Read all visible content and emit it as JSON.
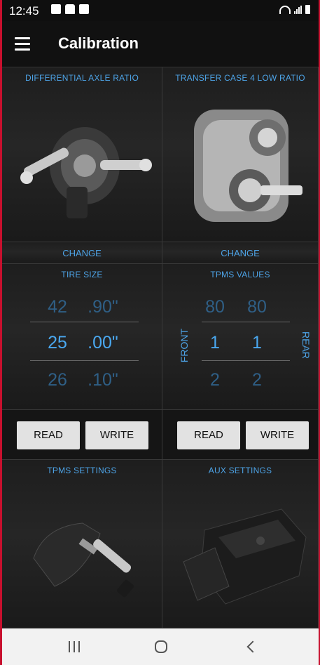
{
  "status_bar": {
    "time": "12:45"
  },
  "app_bar": {
    "title": "Calibration"
  },
  "axle_panel": {
    "label": "DIFFERENTIAL AXLE RATIO",
    "change": "CHANGE"
  },
  "transfer_panel": {
    "label": "TRANSFER CASE 4 LOW RATIO",
    "change": "CHANGE"
  },
  "tire_panel": {
    "label": "TIRE SIZE",
    "rows": [
      {
        "whole": "42",
        "frac": ".90\""
      },
      {
        "whole": "25",
        "frac": ".00\""
      },
      {
        "whole": "26",
        "frac": ".10\""
      }
    ],
    "read": "READ",
    "write": "WRITE"
  },
  "tpms_panel": {
    "label": "TPMS VALUES",
    "front_label": "FRONT",
    "rear_label": "REAR",
    "rows": [
      {
        "front": "80",
        "rear": "80"
      },
      {
        "front": "1",
        "rear": "1"
      },
      {
        "front": "2",
        "rear": "2"
      }
    ],
    "read": "READ",
    "write": "WRITE"
  },
  "tpms_settings_panel": {
    "label": "TPMS SETTINGS"
  },
  "aux_settings_panel": {
    "label": "AUX SETTINGS"
  },
  "colors": {
    "accent": "#4da3e6",
    "frame": "#c8102e",
    "background": "#141414"
  }
}
